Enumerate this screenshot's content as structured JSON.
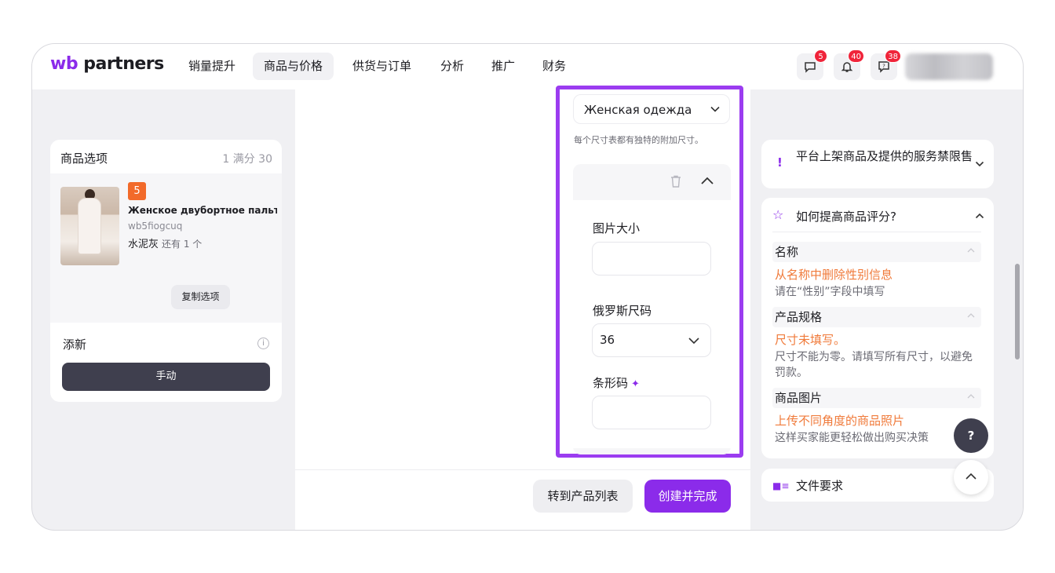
{
  "brand": {
    "logo_prefix": "wb",
    "logo_suffix": " partners"
  },
  "nav": {
    "items": [
      {
        "label": "销量提升"
      },
      {
        "label": "商品与价格"
      },
      {
        "label": "供货与订单"
      },
      {
        "label": "分析"
      },
      {
        "label": "推广"
      },
      {
        "label": "财务"
      }
    ]
  },
  "header_icons": {
    "chat_count": "5",
    "notifications_count": "40",
    "feedback_count": "38"
  },
  "left_panel": {
    "title": "商品选项",
    "counter": "1 满分 30",
    "product": {
      "badge": "5",
      "name": "Женское двубортное пальто...",
      "sku": "wb5fiogcuq",
      "color": "水泥灰",
      "stock": "还有 1 个"
    },
    "copy_label": "复制选项",
    "add_new_label": "添新",
    "manual_label": "手动"
  },
  "size_panel": {
    "category": "Женская одежда",
    "hint": "每个尺寸表都有独特的附加尺寸。",
    "fields": {
      "image_size_label": "图片大小",
      "image_size_value": "",
      "russian_size_label": "俄罗斯尺码",
      "russian_size_value": "36",
      "barcode_label": "条形码",
      "barcode_value": ""
    }
  },
  "footer": {
    "to_list_label": "转到产品列表",
    "create_label": "创建并完成"
  },
  "right_panel": {
    "warning_title": "平台上架商品及提供的服务禁限售",
    "tips_title": "如何提高商品评分?",
    "tips": [
      {
        "head": "名称",
        "error": "从名称中删除性别信息",
        "desc": "请在“性别”字段中填写"
      },
      {
        "head": "产品规格",
        "error": "尺寸未填写。",
        "desc": "尺寸不能为零。请填写所有尺寸，以避免罚款。"
      },
      {
        "head": "商品图片",
        "error": "上传不同角度的商品照片",
        "desc": "这样买家能更轻松做出购买决策"
      }
    ],
    "file_requirements_title": "文件要求"
  },
  "help_label": "?",
  "colors": {
    "accent": "#8b2bea",
    "badge": "#f0243a",
    "warning_text": "#f07a3a"
  }
}
